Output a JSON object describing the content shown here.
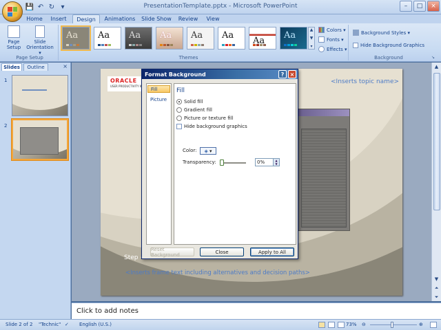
{
  "window": {
    "title": "PresentationTemplate.pptx - Microsoft PowerPoint"
  },
  "quick_access": [
    {
      "name": "save-icon",
      "glyph": "💾"
    },
    {
      "name": "undo-icon",
      "glyph": "↶"
    },
    {
      "name": "redo-icon",
      "glyph": "↻"
    },
    {
      "name": "customize-qat-icon",
      "glyph": "▾"
    }
  ],
  "tabs": [
    "Home",
    "Insert",
    "Design",
    "Animations",
    "Slide Show",
    "Review",
    "View"
  ],
  "active_tab": "Design",
  "ribbon": {
    "page_setup": {
      "page_setup_label_1": "Page",
      "page_setup_label_2": "Setup",
      "orientation_label_1": "Slide",
      "orientation_label_2": "Orientation ▾",
      "group_label": "Page Setup"
    },
    "themes": {
      "group_label": "Themes",
      "colors_label": "Colors ▾",
      "fonts_label": "Fonts ▾",
      "effects_label": "Effects ▾",
      "sample_text": "Aa"
    },
    "background": {
      "styles_label": "Background Styles ▾",
      "hide_graphics_label": "Hide Background Graphics",
      "group_label": "Background"
    }
  },
  "slides_pane": {
    "tab_slides": "Slides",
    "tab_outline": "Outline",
    "close_glyph": "×",
    "slide_numbers": [
      "1",
      "2"
    ]
  },
  "slide": {
    "logo_main": "ORACLE",
    "logo_sub": "USER PRODUCTIVITY KIT",
    "topic_placeholder": "<Inserts topic name>",
    "step_text": "Step <",
    "frame_text": "<Inserts frame text including alternatives and decision paths>"
  },
  "notes": {
    "placeholder": "Click to add notes"
  },
  "status": {
    "slide_info": "Slide 2 of 2",
    "theme": "\"Technic\"",
    "language": "English (U.S.)",
    "zoom": "73%"
  },
  "dialog": {
    "title": "Format Background",
    "help_glyph": "?",
    "close_glyph": "×",
    "nav": [
      "Fill",
      "Picture"
    ],
    "section_title": "Fill",
    "options": {
      "solid_fill": "Solid fill",
      "gradient_fill": "Gradient fill",
      "picture_texture_fill": "Picture or texture fill",
      "hide_background_graphics": "Hide background graphics"
    },
    "color_label": "Color:",
    "transparency_label": "Transparency:",
    "transparency_value": "0%",
    "transparency_fraction": 0,
    "buttons": {
      "reset": "Reset Background",
      "close": "Close",
      "apply_all": "Apply to All"
    }
  },
  "colors": {
    "accent_blue": "#15428b",
    "dialog_title": "#0a246a",
    "selected_orange": "#f4a63a"
  }
}
